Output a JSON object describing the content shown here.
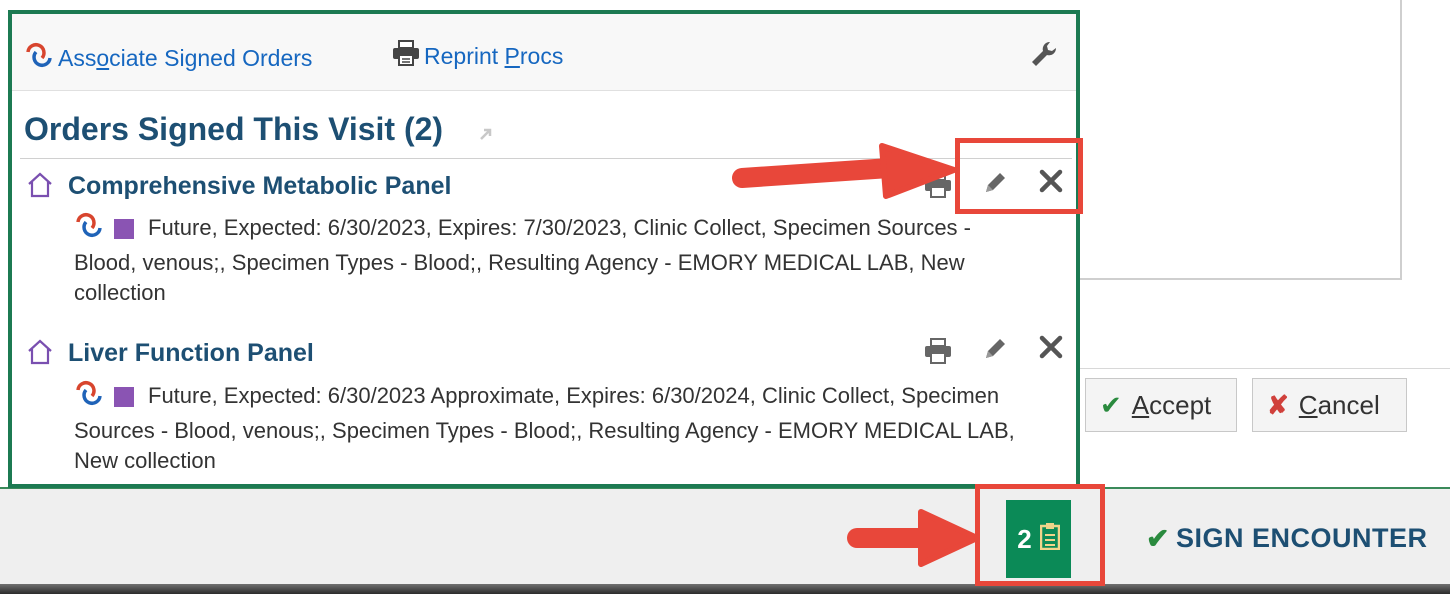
{
  "popup": {
    "toolbar": {
      "associate_label_pre": "Ass",
      "associate_label_ul": "o",
      "associate_label_post": "ciate Signed Orders",
      "reprint_label_pre": "Reprint ",
      "reprint_label_ul": "P",
      "reprint_label_post": "rocs"
    },
    "section_title": "Orders Signed This Visit (2)",
    "orders": [
      {
        "name": "Comprehensive Metabolic Panel",
        "detail": "Future, Expected: 6/30/2023, Expires: 7/30/2023, Clinic Collect, Specimen Sources - Blood, venous;, Specimen Types - Blood;, Resulting Agency - EMORY MEDICAL LAB, New collection"
      },
      {
        "name": "Liver Function Panel",
        "detail": "Future, Expected: 6/30/2023 Approximate, Expires: 6/30/2024, Clinic Collect, Specimen Sources - Blood, venous;, Specimen Types - Blood;, Resulting Agency - EMORY MEDICAL LAB, New collection"
      }
    ]
  },
  "buttons": {
    "accept_ul": "A",
    "accept_rest": "ccept",
    "cancel_ul": "C",
    "cancel_rest": "ancel"
  },
  "footer": {
    "orders_count": "2",
    "sign_encounter": "SIGN ENCOUNTER"
  },
  "icons": {
    "associate": "associate-orders-icon",
    "printer": "printer-icon",
    "wrench": "wrench-icon",
    "house": "house-icon",
    "edit": "pencil-icon",
    "delete": "close-icon",
    "clipboard": "clipboard-icon",
    "popout": "popout-icon"
  },
  "colors": {
    "accent_green": "#0b8a57",
    "title_blue": "#1d4f73",
    "link_blue": "#1667c0",
    "order_status_purple": "#8a54b3",
    "highlight_red": "#e8473a"
  }
}
